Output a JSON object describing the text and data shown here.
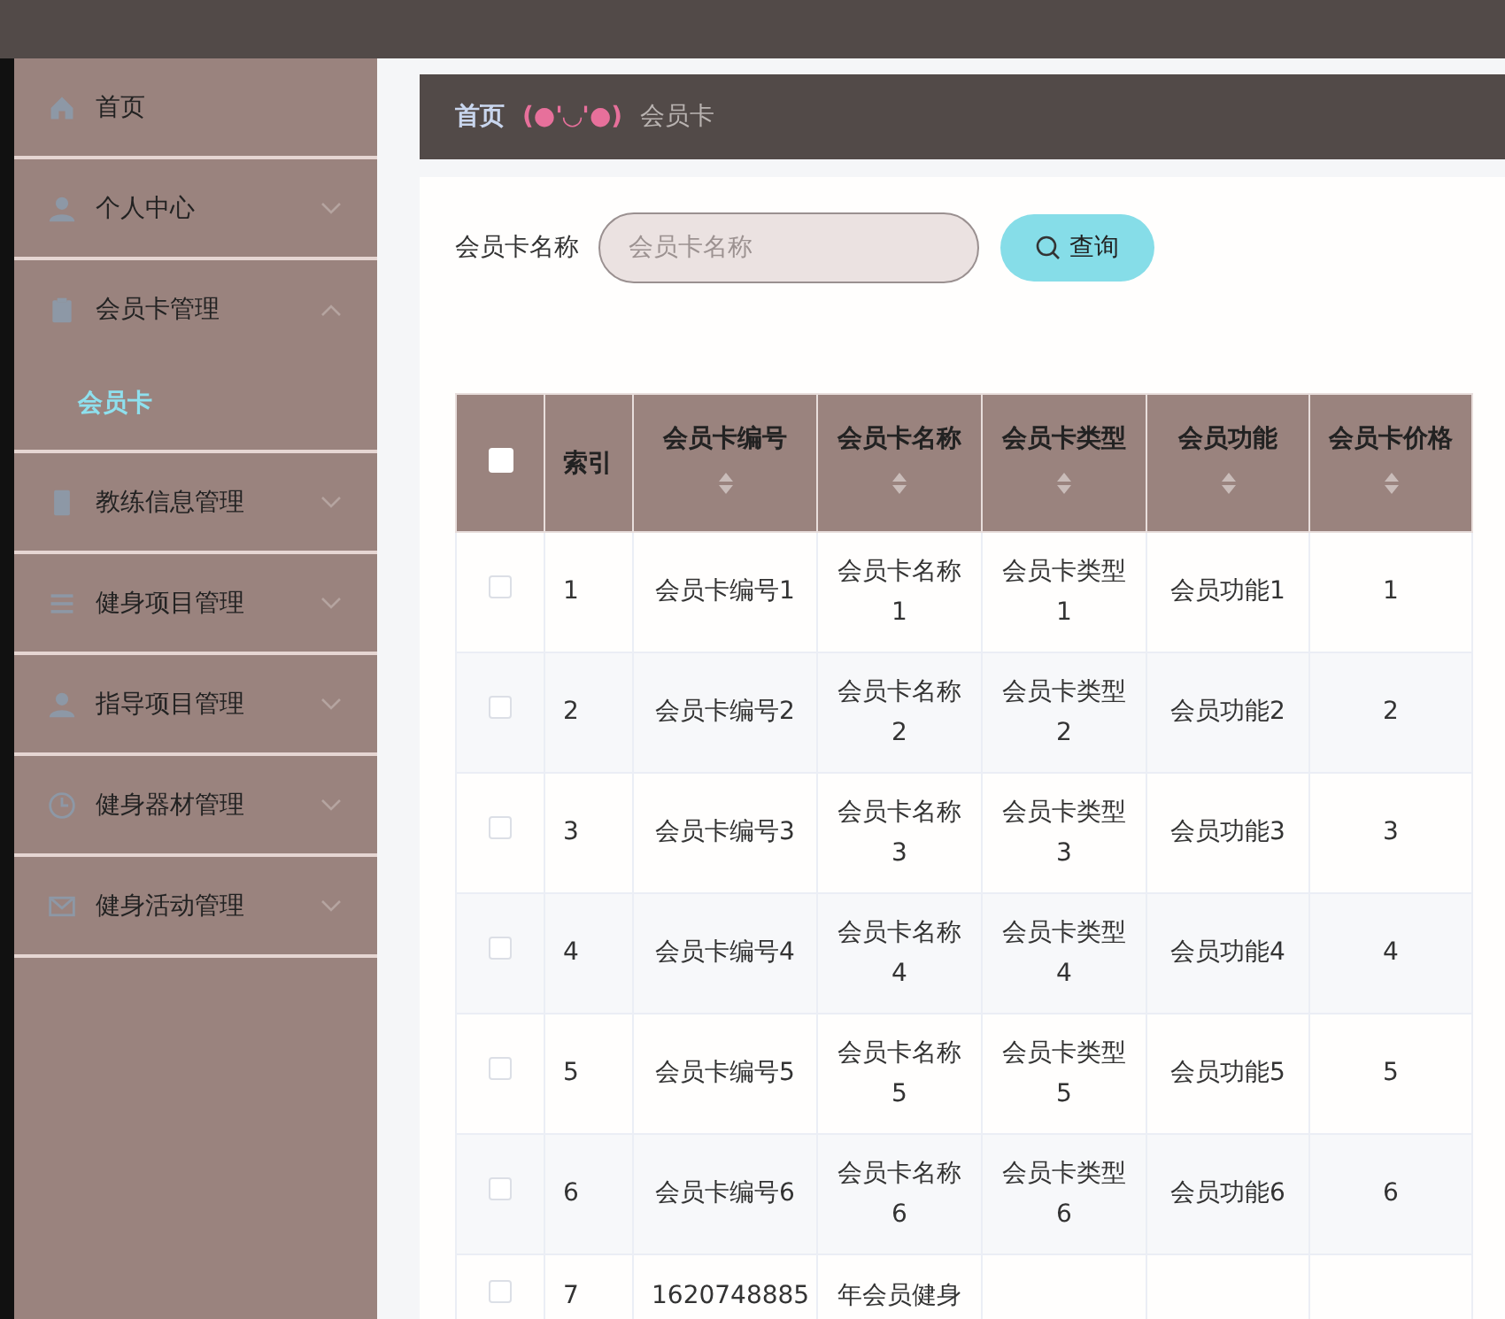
{
  "sidebar": {
    "items": [
      {
        "label": "首页",
        "kind": "link"
      },
      {
        "label": "个人中心",
        "kind": "menu",
        "expanded": false
      },
      {
        "label": "会员卡管理",
        "kind": "menu",
        "expanded": true,
        "children": [
          {
            "label": "会员卡",
            "selected": true
          }
        ]
      },
      {
        "label": "教练信息管理",
        "kind": "menu",
        "expanded": false
      },
      {
        "label": "健身项目管理",
        "kind": "menu",
        "expanded": false
      },
      {
        "label": "指导项目管理",
        "kind": "menu",
        "expanded": false
      },
      {
        "label": "健身器材管理",
        "kind": "menu",
        "expanded": false
      },
      {
        "label": "健身活动管理",
        "kind": "menu",
        "expanded": false
      }
    ]
  },
  "breadcrumb": {
    "home": "首页",
    "separator": "(●'◡'●)",
    "current": "会员卡"
  },
  "search": {
    "label": "会员卡名称",
    "placeholder": "会员卡名称",
    "button": "查询"
  },
  "table": {
    "header_checked": false,
    "columns": [
      {
        "label": "索引",
        "sortable": false
      },
      {
        "label": "会员卡编号",
        "sortable": true
      },
      {
        "label": "会员卡名称",
        "sortable": true
      },
      {
        "label": "会员卡类型",
        "sortable": true
      },
      {
        "label": "会员功能",
        "sortable": true
      },
      {
        "label": "会员卡价格",
        "sortable": true
      }
    ],
    "rows": [
      {
        "checked": false,
        "cells": [
          "1",
          "会员卡编号1",
          "会员卡名称1",
          "会员卡类型1",
          "会员功能1",
          "1"
        ]
      },
      {
        "checked": false,
        "cells": [
          "2",
          "会员卡编号2",
          "会员卡名称2",
          "会员卡类型2",
          "会员功能2",
          "2"
        ]
      },
      {
        "checked": false,
        "cells": [
          "3",
          "会员卡编号3",
          "会员卡名称3",
          "会员卡类型3",
          "会员功能3",
          "3"
        ]
      },
      {
        "checked": false,
        "cells": [
          "4",
          "会员卡编号4",
          "会员卡名称4",
          "会员卡类型4",
          "会员功能4",
          "4"
        ]
      },
      {
        "checked": false,
        "cells": [
          "5",
          "会员卡编号5",
          "会员卡名称5",
          "会员卡类型5",
          "会员功能5",
          "5"
        ]
      },
      {
        "checked": false,
        "cells": [
          "6",
          "会员卡编号6",
          "会员卡名称6",
          "会员卡类型6",
          "会员功能6",
          "6"
        ]
      },
      {
        "checked": false,
        "cells": [
          "7",
          "1620748885",
          "年会员健身"
        ]
      }
    ]
  }
}
